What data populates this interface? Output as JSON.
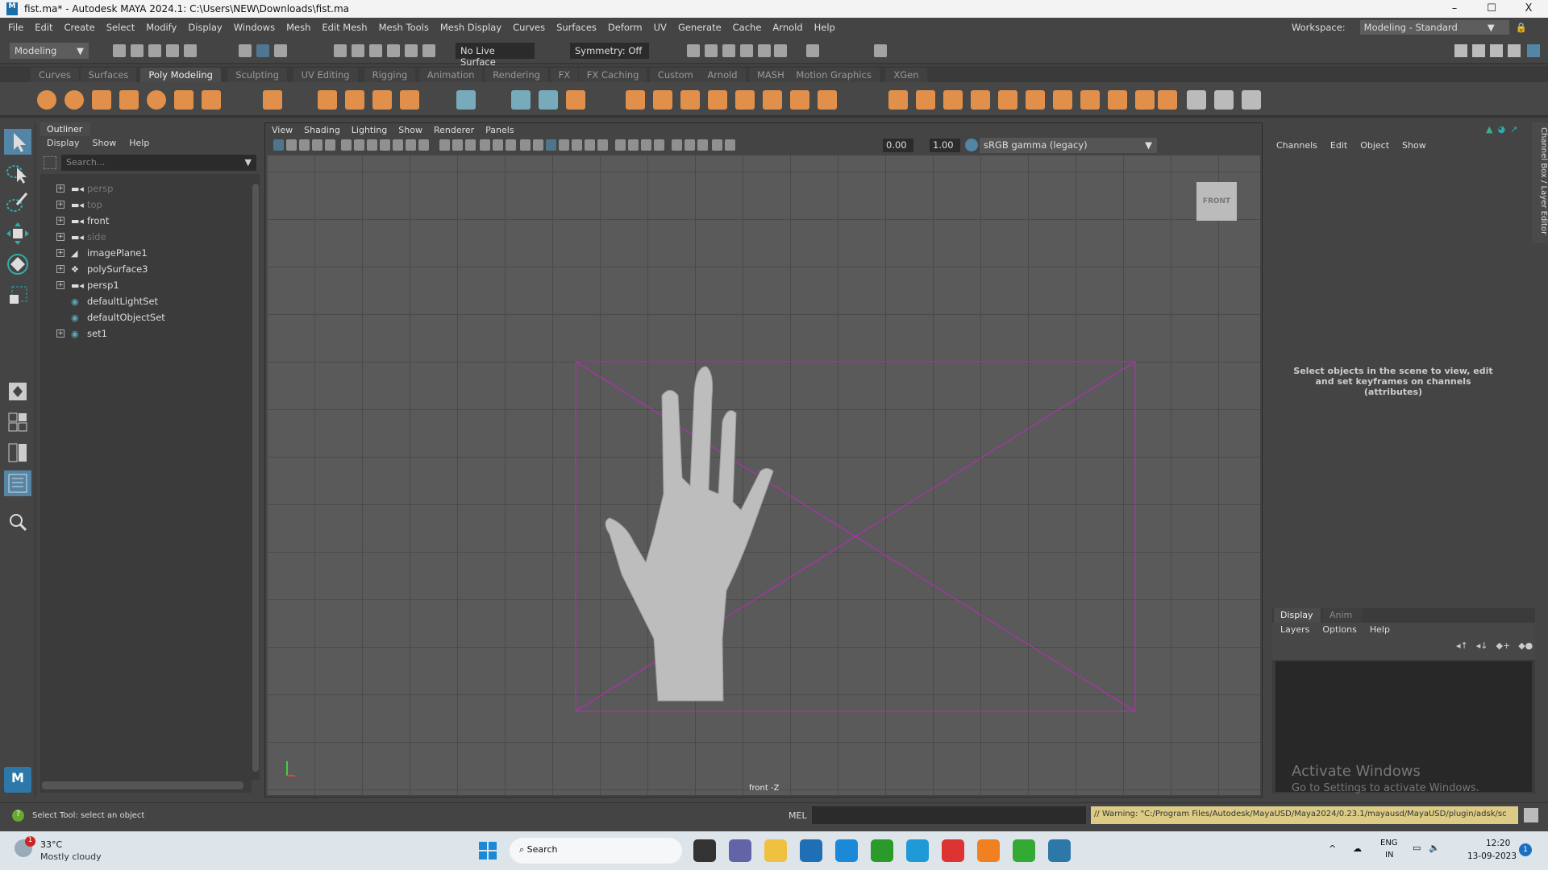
{
  "window": {
    "title": "fist.ma* - Autodesk MAYA 2024.1: C:\\Users\\NEW\\Downloads\\fist.ma",
    "minimize": "–",
    "maximize": "☐",
    "close": "X"
  },
  "menubar": [
    "File",
    "Edit",
    "Create",
    "Select",
    "Modify",
    "Display",
    "Windows",
    "Mesh",
    "Edit Mesh",
    "Mesh Tools",
    "Mesh Display",
    "Curves",
    "Surfaces",
    "Deform",
    "UV",
    "Generate",
    "Cache",
    "Arnold",
    "Help"
  ],
  "workspace": {
    "label": "Workspace:",
    "value": "Modeling - Standard"
  },
  "statusline": {
    "menuset": "Modeling",
    "live_surface": "No Live Surface",
    "symmetry": "Symmetry: Off"
  },
  "shelf_tabs": [
    "Curves",
    "Surfaces",
    "Poly Modeling",
    "Sculpting",
    "UV Editing",
    "Rigging",
    "Animation",
    "Rendering",
    "FX",
    "FX Caching",
    "Custom",
    "Arnold",
    "MASH",
    "Motion Graphics",
    "XGen"
  ],
  "shelf_active": "Poly Modeling",
  "outliner": {
    "title": "Outliner",
    "menus": [
      "Display",
      "Show",
      "Help"
    ],
    "search_placeholder": "Search...",
    "items": [
      {
        "name": "persp",
        "icon": "camera",
        "expand": true,
        "dim": true
      },
      {
        "name": "top",
        "icon": "camera",
        "expand": true,
        "dim": true
      },
      {
        "name": "front",
        "icon": "camera",
        "expand": true,
        "dim": false
      },
      {
        "name": "side",
        "icon": "camera",
        "expand": true,
        "dim": true
      },
      {
        "name": "imagePlane1",
        "icon": "imageplane",
        "expand": true,
        "dim": false
      },
      {
        "name": "polySurface3",
        "icon": "mesh",
        "expand": true,
        "dim": false
      },
      {
        "name": "persp1",
        "icon": "camera",
        "expand": true,
        "dim": false
      },
      {
        "name": "defaultLightSet",
        "icon": "set",
        "expand": false,
        "dim": false
      },
      {
        "name": "defaultObjectSet",
        "icon": "set",
        "expand": false,
        "dim": false
      },
      {
        "name": "set1",
        "icon": "set",
        "expand": true,
        "dim": false
      }
    ]
  },
  "viewport": {
    "menus": [
      "View",
      "Shading",
      "Lighting",
      "Show",
      "Renderer",
      "Panels"
    ],
    "exposure": "0.00",
    "gamma": "1.00",
    "color_space": "sRGB gamma (legacy)",
    "camera_label": "front -Z",
    "viewcube": "FRONT"
  },
  "channelbox": {
    "menus": [
      "Channels",
      "Edit",
      "Object",
      "Show"
    ],
    "message": "Select objects in the scene to view, edit and set keyframes on channels (attributes)",
    "side_tab": "Channel Box / Layer Editor"
  },
  "layers": {
    "tabs": [
      "Display",
      "Anim"
    ],
    "menus": [
      "Layers",
      "Options",
      "Help"
    ]
  },
  "watermark": {
    "title": "Activate Windows",
    "subtitle": "Go to Settings to activate Windows."
  },
  "helpline": {
    "text": "Select Tool: select an object",
    "mel_label": "MEL",
    "warning": "// Warning: \"C:/Program Files/Autodesk/MayaUSD/Maya2024/0.23.1/mayausd/MayaUSD/plugin/adsk/sc"
  },
  "taskbar": {
    "weather_temp": "33°C",
    "weather_desc": "Mostly cloudy",
    "weather_badge": "1",
    "search": "Search",
    "lang1": "ENG",
    "lang2": "IN",
    "time": "12:20",
    "date": "13-09-2023",
    "notif": "1"
  },
  "colors": {
    "accent": "#5285a6",
    "shelf_icon": "#e0904a",
    "frame": "#b030b0"
  }
}
